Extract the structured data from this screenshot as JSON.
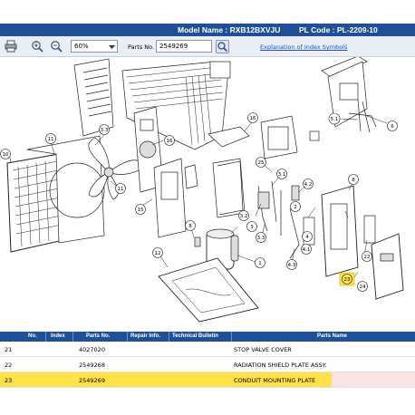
{
  "header": {
    "model_name": "Model Name : RXB12BXVJU",
    "pl_code": "PL Code : PL-2209-10"
  },
  "toolbar": {
    "zoom_value": "60%",
    "parts_no_label": "Parts No.",
    "parts_no_value": "2549269",
    "index_link": "Explanation of Index Symbols",
    "icons": [
      "printer-icon",
      "zoom-in-icon",
      "zoom-out-icon",
      "search-icon"
    ]
  },
  "diagram": {
    "callouts": [
      "1",
      "2",
      "3",
      "3.1",
      "3.2",
      "3.3",
      "4",
      "4.1",
      "4.2",
      "4.3",
      "5",
      "5.1",
      "6",
      "7",
      "8",
      "10",
      "11",
      "12",
      "15",
      "16",
      "17",
      "18",
      "19",
      "20",
      "21",
      "22",
      "23",
      "24",
      "25"
    ],
    "highlighted": "23"
  },
  "table": {
    "headers": [
      "No.",
      "Index",
      "Parts No.",
      "Repair Info.",
      "Technical Bulletin",
      "Parts Name"
    ],
    "rows": [
      {
        "no": "21",
        "index": "",
        "parts_no": "4027020",
        "parts_name": "STOP VALVE COVER",
        "selected": false
      },
      {
        "no": "22",
        "index": "",
        "parts_no": "2549268",
        "parts_name": "RADIATION SHIELD PLATE ASSY.",
        "selected": false
      },
      {
        "no": "23",
        "index": "",
        "parts_no": "2549269",
        "parts_name": "CONDUIT MOUNTING PLATE",
        "selected": true
      }
    ]
  },
  "colors": {
    "header_bar": "#1f4f97",
    "toolbar_bg": "#e9eef5",
    "selected_row": "#ffe24a",
    "link": "#1c4fd6"
  }
}
